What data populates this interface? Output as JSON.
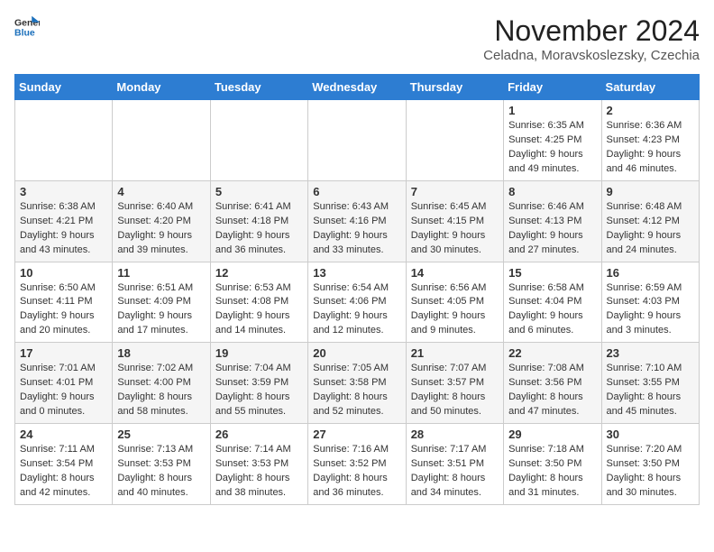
{
  "header": {
    "logo_line1": "General",
    "logo_line2": "Blue",
    "month_title": "November 2024",
    "location": "Celadna, Moravskoslezsky, Czechia"
  },
  "weekdays": [
    "Sunday",
    "Monday",
    "Tuesday",
    "Wednesday",
    "Thursday",
    "Friday",
    "Saturday"
  ],
  "weeks": [
    [
      {
        "day": "",
        "detail": ""
      },
      {
        "day": "",
        "detail": ""
      },
      {
        "day": "",
        "detail": ""
      },
      {
        "day": "",
        "detail": ""
      },
      {
        "day": "",
        "detail": ""
      },
      {
        "day": "1",
        "detail": "Sunrise: 6:35 AM\nSunset: 4:25 PM\nDaylight: 9 hours\nand 49 minutes."
      },
      {
        "day": "2",
        "detail": "Sunrise: 6:36 AM\nSunset: 4:23 PM\nDaylight: 9 hours\nand 46 minutes."
      }
    ],
    [
      {
        "day": "3",
        "detail": "Sunrise: 6:38 AM\nSunset: 4:21 PM\nDaylight: 9 hours\nand 43 minutes."
      },
      {
        "day": "4",
        "detail": "Sunrise: 6:40 AM\nSunset: 4:20 PM\nDaylight: 9 hours\nand 39 minutes."
      },
      {
        "day": "5",
        "detail": "Sunrise: 6:41 AM\nSunset: 4:18 PM\nDaylight: 9 hours\nand 36 minutes."
      },
      {
        "day": "6",
        "detail": "Sunrise: 6:43 AM\nSunset: 4:16 PM\nDaylight: 9 hours\nand 33 minutes."
      },
      {
        "day": "7",
        "detail": "Sunrise: 6:45 AM\nSunset: 4:15 PM\nDaylight: 9 hours\nand 30 minutes."
      },
      {
        "day": "8",
        "detail": "Sunrise: 6:46 AM\nSunset: 4:13 PM\nDaylight: 9 hours\nand 27 minutes."
      },
      {
        "day": "9",
        "detail": "Sunrise: 6:48 AM\nSunset: 4:12 PM\nDaylight: 9 hours\nand 24 minutes."
      }
    ],
    [
      {
        "day": "10",
        "detail": "Sunrise: 6:50 AM\nSunset: 4:11 PM\nDaylight: 9 hours\nand 20 minutes."
      },
      {
        "day": "11",
        "detail": "Sunrise: 6:51 AM\nSunset: 4:09 PM\nDaylight: 9 hours\nand 17 minutes."
      },
      {
        "day": "12",
        "detail": "Sunrise: 6:53 AM\nSunset: 4:08 PM\nDaylight: 9 hours\nand 14 minutes."
      },
      {
        "day": "13",
        "detail": "Sunrise: 6:54 AM\nSunset: 4:06 PM\nDaylight: 9 hours\nand 12 minutes."
      },
      {
        "day": "14",
        "detail": "Sunrise: 6:56 AM\nSunset: 4:05 PM\nDaylight: 9 hours\nand 9 minutes."
      },
      {
        "day": "15",
        "detail": "Sunrise: 6:58 AM\nSunset: 4:04 PM\nDaylight: 9 hours\nand 6 minutes."
      },
      {
        "day": "16",
        "detail": "Sunrise: 6:59 AM\nSunset: 4:03 PM\nDaylight: 9 hours\nand 3 minutes."
      }
    ],
    [
      {
        "day": "17",
        "detail": "Sunrise: 7:01 AM\nSunset: 4:01 PM\nDaylight: 9 hours\nand 0 minutes."
      },
      {
        "day": "18",
        "detail": "Sunrise: 7:02 AM\nSunset: 4:00 PM\nDaylight: 8 hours\nand 58 minutes."
      },
      {
        "day": "19",
        "detail": "Sunrise: 7:04 AM\nSunset: 3:59 PM\nDaylight: 8 hours\nand 55 minutes."
      },
      {
        "day": "20",
        "detail": "Sunrise: 7:05 AM\nSunset: 3:58 PM\nDaylight: 8 hours\nand 52 minutes."
      },
      {
        "day": "21",
        "detail": "Sunrise: 7:07 AM\nSunset: 3:57 PM\nDaylight: 8 hours\nand 50 minutes."
      },
      {
        "day": "22",
        "detail": "Sunrise: 7:08 AM\nSunset: 3:56 PM\nDaylight: 8 hours\nand 47 minutes."
      },
      {
        "day": "23",
        "detail": "Sunrise: 7:10 AM\nSunset: 3:55 PM\nDaylight: 8 hours\nand 45 minutes."
      }
    ],
    [
      {
        "day": "24",
        "detail": "Sunrise: 7:11 AM\nSunset: 3:54 PM\nDaylight: 8 hours\nand 42 minutes."
      },
      {
        "day": "25",
        "detail": "Sunrise: 7:13 AM\nSunset: 3:53 PM\nDaylight: 8 hours\nand 40 minutes."
      },
      {
        "day": "26",
        "detail": "Sunrise: 7:14 AM\nSunset: 3:53 PM\nDaylight: 8 hours\nand 38 minutes."
      },
      {
        "day": "27",
        "detail": "Sunrise: 7:16 AM\nSunset: 3:52 PM\nDaylight: 8 hours\nand 36 minutes."
      },
      {
        "day": "28",
        "detail": "Sunrise: 7:17 AM\nSunset: 3:51 PM\nDaylight: 8 hours\nand 34 minutes."
      },
      {
        "day": "29",
        "detail": "Sunrise: 7:18 AM\nSunset: 3:50 PM\nDaylight: 8 hours\nand 31 minutes."
      },
      {
        "day": "30",
        "detail": "Sunrise: 7:20 AM\nSunset: 3:50 PM\nDaylight: 8 hours\nand 30 minutes."
      }
    ]
  ]
}
